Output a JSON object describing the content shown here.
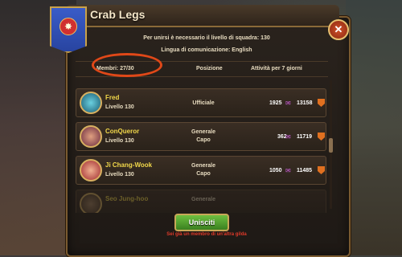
{
  "guild": {
    "name": "Crab Legs"
  },
  "info": {
    "requirement": "Per unirsi è necessario il livello di squadra: 130",
    "language": "Lingua di comunicazione: English"
  },
  "table": {
    "members_header": "Membri: 27/30",
    "position_header": "Posizione",
    "activity_header": "Attività per 7 giorni"
  },
  "members": [
    {
      "name": "Fred",
      "level": "Livello 130",
      "role1": "Ufficiale",
      "role2": "",
      "stat1": "1925",
      "stat2": "13158"
    },
    {
      "name": "ConQueror",
      "level": "Livello 130",
      "role1": "Generale",
      "role2": "Capo",
      "stat1": "362",
      "stat2": "11719"
    },
    {
      "name": "Ji Chang-Wook",
      "level": "Livello 130",
      "role1": "Generale",
      "role2": "Capo",
      "stat1": "1050",
      "stat2": "11485"
    },
    {
      "name": "Seo Jung-hoo",
      "level": "",
      "role1": "Generale",
      "role2": "",
      "stat1": "",
      "stat2": ""
    }
  ],
  "actions": {
    "join_label": "Unisciti",
    "warning": "Sei già un membro di un'altra gilda"
  },
  "icons": {
    "close": "close-icon",
    "emblem": "crab-emblem-icon",
    "activity_a": "mail-icon",
    "activity_b": "shield-icon"
  },
  "colors": {
    "accent_yellow": "#f2d84a",
    "highlight_circle": "#e04818",
    "join_green": "#5aa830",
    "warning_red": "#e03a2a"
  }
}
